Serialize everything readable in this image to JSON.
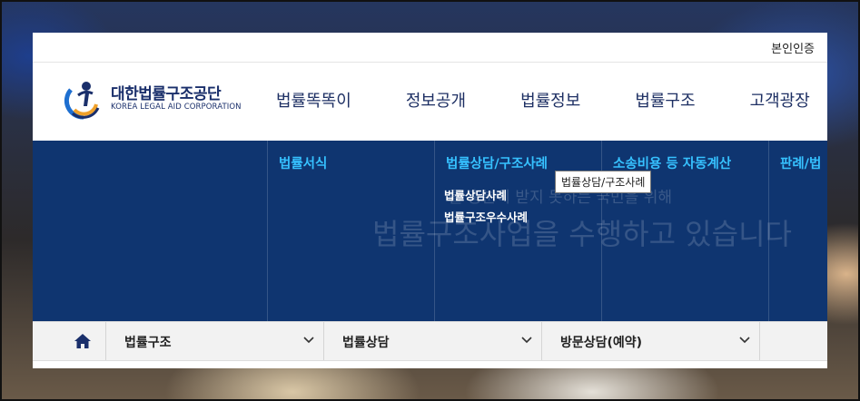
{
  "topbar": {
    "auth_label": "본인인증"
  },
  "logo": {
    "name_ko": "대한법률구조공단",
    "name_en": "KOREA LEGAL AID CORPORATION"
  },
  "gnb": [
    "법률똑똑이",
    "정보공개",
    "법률정보",
    "법률구조",
    "고객광장"
  ],
  "mega": {
    "columns": [
      {
        "title": "법률서식",
        "subs": []
      },
      {
        "title": "법률상담/구조사례",
        "subs": [
          "법률상담사례",
          "법률구조우수사례"
        ]
      },
      {
        "title": "소송비용 등 자동계산",
        "subs": []
      },
      {
        "title": "판례/법",
        "subs": []
      }
    ],
    "tooltip": "법률상담/구조사례",
    "ghost_line1": "를 충분히 받지 못하는 국민을 위해",
    "ghost_line2": "법률구조사업을 수행하고 있습니다"
  },
  "breadcrumb": {
    "home_icon": "home-icon",
    "items": [
      "법률구조",
      "법률상담",
      "방문상담(예약)",
      ""
    ]
  },
  "colors": {
    "navy": "#0f3570",
    "accent": "#36c1ff",
    "brand": "#1d2f63"
  }
}
